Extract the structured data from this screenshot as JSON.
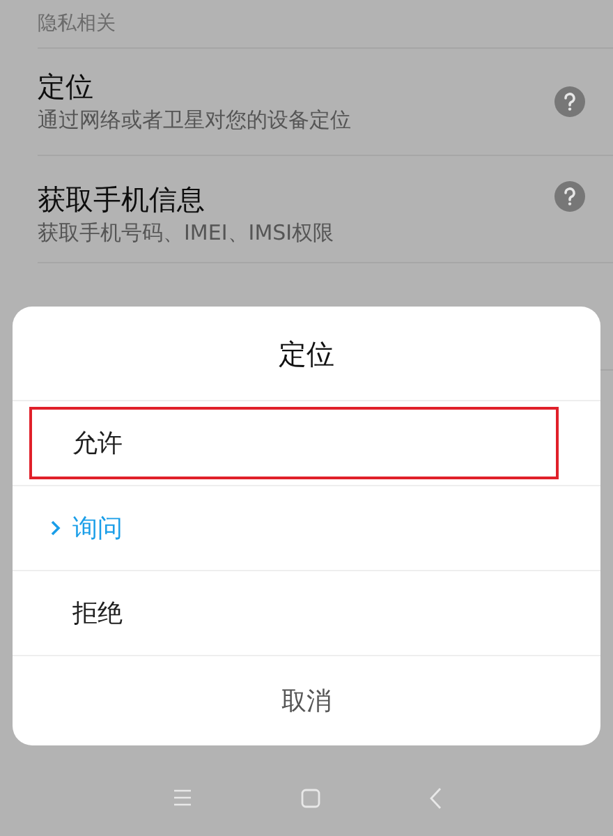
{
  "section_header": "隐私相关",
  "settings": [
    {
      "title": "定位",
      "subtitle": "通过网络或者卫星对您的设备定位",
      "kind": "help"
    },
    {
      "title": "获取手机信息",
      "subtitle": "获取手机号码、IMEI、IMSI权限",
      "kind": "help"
    }
  ],
  "dialog": {
    "title": "定位",
    "options": [
      {
        "label": "允许",
        "selected": false,
        "highlighted": true
      },
      {
        "label": "询问",
        "selected": true,
        "highlighted": false
      },
      {
        "label": "拒绝",
        "selected": false,
        "highlighted": false
      }
    ],
    "cancel": "取消"
  }
}
